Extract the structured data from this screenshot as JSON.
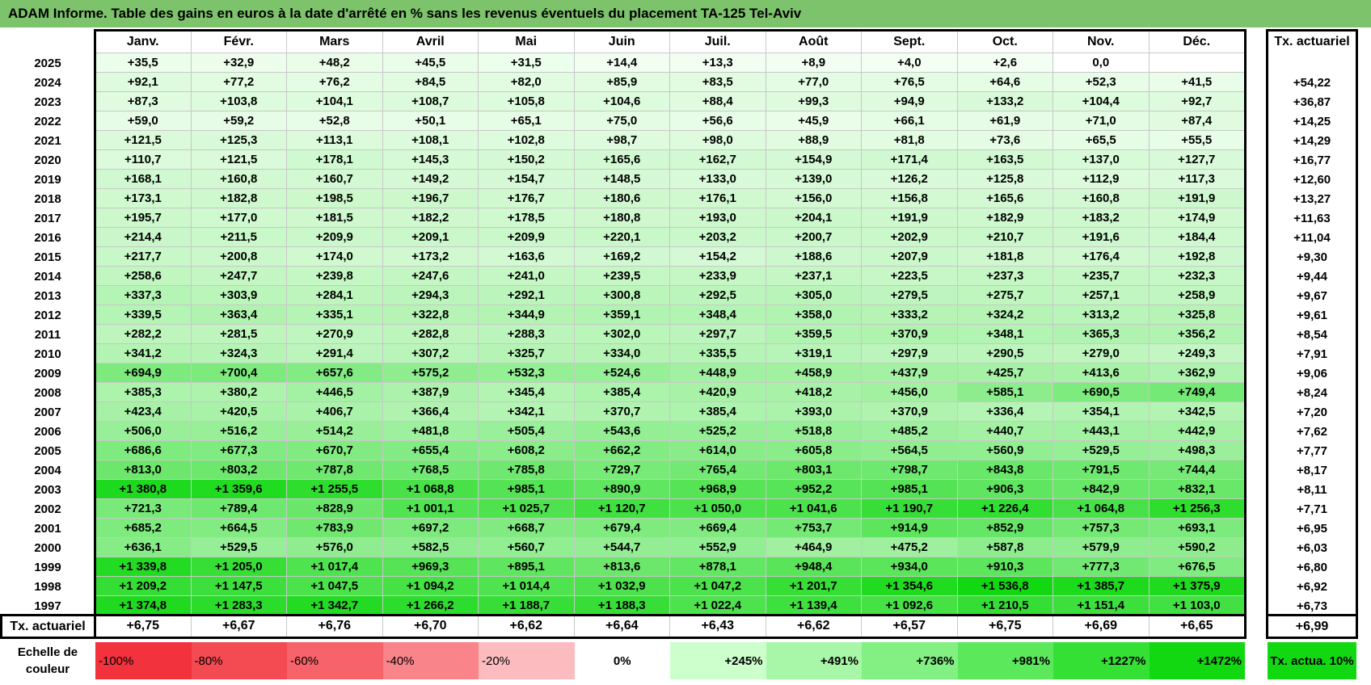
{
  "title": "ADAM Informe. Table des gains en euros à la date d'arrêté en % sans les revenus éventuels du placement TA-125 Tel-Aviv",
  "months": [
    "Janv.",
    "Févr.",
    "Mars",
    "Avril",
    "Mai",
    "Juin",
    "Juil.",
    "Août",
    "Sept.",
    "Oct.",
    "Nov.",
    "Déc."
  ],
  "rate_header": "Tx. actuariel",
  "rows": [
    {
      "year": "2025",
      "values": [
        "+35,5",
        "+32,9",
        "+48,2",
        "+45,5",
        "+31,5",
        "+14,4",
        "+13,3",
        "+8,9",
        "+4,0",
        "+2,6",
        "0,0",
        ""
      ],
      "rate": ""
    },
    {
      "year": "2024",
      "values": [
        "+92,1",
        "+77,2",
        "+76,2",
        "+84,5",
        "+82,0",
        "+85,9",
        "+83,5",
        "+77,0",
        "+76,5",
        "+64,6",
        "+52,3",
        "+41,5"
      ],
      "rate": "+54,22"
    },
    {
      "year": "2023",
      "values": [
        "+87,3",
        "+103,8",
        "+104,1",
        "+108,7",
        "+105,8",
        "+104,6",
        "+88,4",
        "+99,3",
        "+94,9",
        "+133,2",
        "+104,4",
        "+92,7"
      ],
      "rate": "+36,87"
    },
    {
      "year": "2022",
      "values": [
        "+59,0",
        "+59,2",
        "+52,8",
        "+50,1",
        "+65,1",
        "+75,0",
        "+56,6",
        "+45,9",
        "+66,1",
        "+61,9",
        "+71,0",
        "+87,4"
      ],
      "rate": "+14,25"
    },
    {
      "year": "2021",
      "values": [
        "+121,5",
        "+125,3",
        "+113,1",
        "+108,1",
        "+102,8",
        "+98,7",
        "+98,0",
        "+88,9",
        "+81,8",
        "+73,6",
        "+65,5",
        "+55,5"
      ],
      "rate": "+14,29"
    },
    {
      "year": "2020",
      "values": [
        "+110,7",
        "+121,5",
        "+178,1",
        "+145,3",
        "+150,2",
        "+165,6",
        "+162,7",
        "+154,9",
        "+171,4",
        "+163,5",
        "+137,0",
        "+127,7"
      ],
      "rate": "+16,77"
    },
    {
      "year": "2019",
      "values": [
        "+168,1",
        "+160,8",
        "+160,7",
        "+149,2",
        "+154,7",
        "+148,5",
        "+133,0",
        "+139,0",
        "+126,2",
        "+125,8",
        "+112,9",
        "+117,3"
      ],
      "rate": "+12,60"
    },
    {
      "year": "2018",
      "values": [
        "+173,1",
        "+182,8",
        "+198,5",
        "+196,7",
        "+176,7",
        "+180,6",
        "+176,1",
        "+156,0",
        "+156,8",
        "+165,6",
        "+160,8",
        "+191,9"
      ],
      "rate": "+13,27"
    },
    {
      "year": "2017",
      "values": [
        "+195,7",
        "+177,0",
        "+181,5",
        "+182,2",
        "+178,5",
        "+180,8",
        "+193,0",
        "+204,1",
        "+191,9",
        "+182,9",
        "+183,2",
        "+174,9"
      ],
      "rate": "+11,63"
    },
    {
      "year": "2016",
      "values": [
        "+214,4",
        "+211,5",
        "+209,9",
        "+209,1",
        "+209,9",
        "+220,1",
        "+203,2",
        "+200,7",
        "+202,9",
        "+210,7",
        "+191,6",
        "+184,4"
      ],
      "rate": "+11,04"
    },
    {
      "year": "2015",
      "values": [
        "+217,7",
        "+200,8",
        "+174,0",
        "+173,2",
        "+163,6",
        "+169,2",
        "+154,2",
        "+188,6",
        "+207,9",
        "+181,8",
        "+176,4",
        "+192,8"
      ],
      "rate": "+9,30"
    },
    {
      "year": "2014",
      "values": [
        "+258,6",
        "+247,7",
        "+239,8",
        "+247,6",
        "+241,0",
        "+239,5",
        "+233,9",
        "+237,1",
        "+223,5",
        "+237,3",
        "+235,7",
        "+232,3"
      ],
      "rate": "+9,44"
    },
    {
      "year": "2013",
      "values": [
        "+337,3",
        "+303,9",
        "+284,1",
        "+294,3",
        "+292,1",
        "+300,8",
        "+292,5",
        "+305,0",
        "+279,5",
        "+275,7",
        "+257,1",
        "+258,9"
      ],
      "rate": "+9,67"
    },
    {
      "year": "2012",
      "values": [
        "+339,5",
        "+363,4",
        "+335,1",
        "+322,8",
        "+344,9",
        "+359,1",
        "+348,4",
        "+358,0",
        "+333,2",
        "+324,2",
        "+313,2",
        "+325,8"
      ],
      "rate": "+9,61"
    },
    {
      "year": "2011",
      "values": [
        "+282,2",
        "+281,5",
        "+270,9",
        "+282,8",
        "+288,3",
        "+302,0",
        "+297,7",
        "+359,5",
        "+370,9",
        "+348,1",
        "+365,3",
        "+356,2"
      ],
      "rate": "+8,54"
    },
    {
      "year": "2010",
      "values": [
        "+341,2",
        "+324,3",
        "+291,4",
        "+307,2",
        "+325,7",
        "+334,0",
        "+335,5",
        "+319,1",
        "+297,9",
        "+290,5",
        "+279,0",
        "+249,3"
      ],
      "rate": "+7,91"
    },
    {
      "year": "2009",
      "values": [
        "+694,9",
        "+700,4",
        "+657,6",
        "+575,2",
        "+532,3",
        "+524,6",
        "+448,9",
        "+458,9",
        "+437,9",
        "+425,7",
        "+413,6",
        "+362,9"
      ],
      "rate": "+9,06"
    },
    {
      "year": "2008",
      "values": [
        "+385,3",
        "+380,2",
        "+446,5",
        "+387,9",
        "+345,4",
        "+385,4",
        "+420,9",
        "+418,2",
        "+456,0",
        "+585,1",
        "+690,5",
        "+749,4"
      ],
      "rate": "+8,24"
    },
    {
      "year": "2007",
      "values": [
        "+423,4",
        "+420,5",
        "+406,7",
        "+366,4",
        "+342,1",
        "+370,7",
        "+385,4",
        "+393,0",
        "+370,9",
        "+336,4",
        "+354,1",
        "+342,5"
      ],
      "rate": "+7,20"
    },
    {
      "year": "2006",
      "values": [
        "+506,0",
        "+516,2",
        "+514,2",
        "+481,8",
        "+505,4",
        "+543,6",
        "+525,2",
        "+518,8",
        "+485,2",
        "+440,7",
        "+443,1",
        "+442,9"
      ],
      "rate": "+7,62"
    },
    {
      "year": "2005",
      "values": [
        "+686,6",
        "+677,3",
        "+670,7",
        "+655,4",
        "+608,2",
        "+662,2",
        "+614,0",
        "+605,8",
        "+564,5",
        "+560,9",
        "+529,5",
        "+498,3"
      ],
      "rate": "+7,77"
    },
    {
      "year": "2004",
      "values": [
        "+813,0",
        "+803,2",
        "+787,8",
        "+768,5",
        "+785,8",
        "+729,7",
        "+765,4",
        "+803,1",
        "+798,7",
        "+843,8",
        "+791,5",
        "+744,4"
      ],
      "rate": "+8,17"
    },
    {
      "year": "2003",
      "values": [
        "+1 380,8",
        "+1 359,6",
        "+1 255,5",
        "+1 068,8",
        "+985,1",
        "+890,9",
        "+968,9",
        "+952,2",
        "+985,1",
        "+906,3",
        "+842,9",
        "+832,1"
      ],
      "rate": "+8,11"
    },
    {
      "year": "2002",
      "values": [
        "+721,3",
        "+789,4",
        "+828,9",
        "+1 001,1",
        "+1 025,7",
        "+1 120,7",
        "+1 050,0",
        "+1 041,6",
        "+1 190,7",
        "+1 226,4",
        "+1 064,8",
        "+1 256,3"
      ],
      "rate": "+7,71"
    },
    {
      "year": "2001",
      "values": [
        "+685,2",
        "+664,5",
        "+783,9",
        "+697,2",
        "+668,7",
        "+679,4",
        "+669,4",
        "+753,7",
        "+914,9",
        "+852,9",
        "+757,3",
        "+693,1"
      ],
      "rate": "+6,95"
    },
    {
      "year": "2000",
      "values": [
        "+636,1",
        "+529,5",
        "+576,0",
        "+582,5",
        "+560,7",
        "+544,7",
        "+552,9",
        "+464,9",
        "+475,2",
        "+587,8",
        "+579,9",
        "+590,2"
      ],
      "rate": "+6,03"
    },
    {
      "year": "1999",
      "values": [
        "+1 339,8",
        "+1 205,0",
        "+1 017,4",
        "+969,3",
        "+895,1",
        "+813,6",
        "+878,1",
        "+948,4",
        "+934,0",
        "+910,3",
        "+777,3",
        "+676,5"
      ],
      "rate": "+6,80"
    },
    {
      "year": "1998",
      "values": [
        "+1 209,2",
        "+1 147,5",
        "+1 047,5",
        "+1 094,2",
        "+1 014,4",
        "+1 032,9",
        "+1 047,2",
        "+1 201,7",
        "+1 354,6",
        "+1 536,8",
        "+1 385,7",
        "+1 375,9"
      ],
      "rate": "+6,92"
    },
    {
      "year": "1997",
      "values": [
        "+1 374,8",
        "+1 283,3",
        "+1 342,7",
        "+1 266,2",
        "+1 188,7",
        "+1 188,3",
        "+1 022,4",
        "+1 139,4",
        "+1 092,6",
        "+1 210,5",
        "+1 151,4",
        "+1 103,0"
      ],
      "rate": "+6,73"
    }
  ],
  "footer": {
    "label": "Tx. actuariel",
    "values": [
      "+6,75",
      "+6,67",
      "+6,76",
      "+6,70",
      "+6,62",
      "+6,64",
      "+6,43",
      "+6,62",
      "+6,57",
      "+6,75",
      "+6,69",
      "+6,65"
    ],
    "rate": "+6,99"
  },
  "scale": {
    "label": "Echelle de couleur",
    "items": [
      {
        "text": "-100%",
        "color": "#f2323c"
      },
      {
        "text": "-80%",
        "color": "#f44a52"
      },
      {
        "text": "-60%",
        "color": "#f6636a"
      },
      {
        "text": "-40%",
        "color": "#f98489"
      },
      {
        "text": "-20%",
        "color": "#fcbcbf"
      },
      {
        "text": "0%",
        "color": "#ffffff"
      },
      {
        "text": "+245%",
        "color": "#ccffcc"
      },
      {
        "text": "+491%",
        "color": "#a8f7a8"
      },
      {
        "text": "+736%",
        "color": "#82f082"
      },
      {
        "text": "+981%",
        "color": "#5be85b"
      },
      {
        "text": "+1227%",
        "color": "#35e035"
      },
      {
        "text": "+1472%",
        "color": "#12d812"
      }
    ],
    "target_label": "Tx. actua. 10%",
    "target_color": "#12d812"
  },
  "colors": {
    "title_bar": "#7dc36b",
    "pos_low": "#f5fff5",
    "pos_high": "#12d812"
  }
}
